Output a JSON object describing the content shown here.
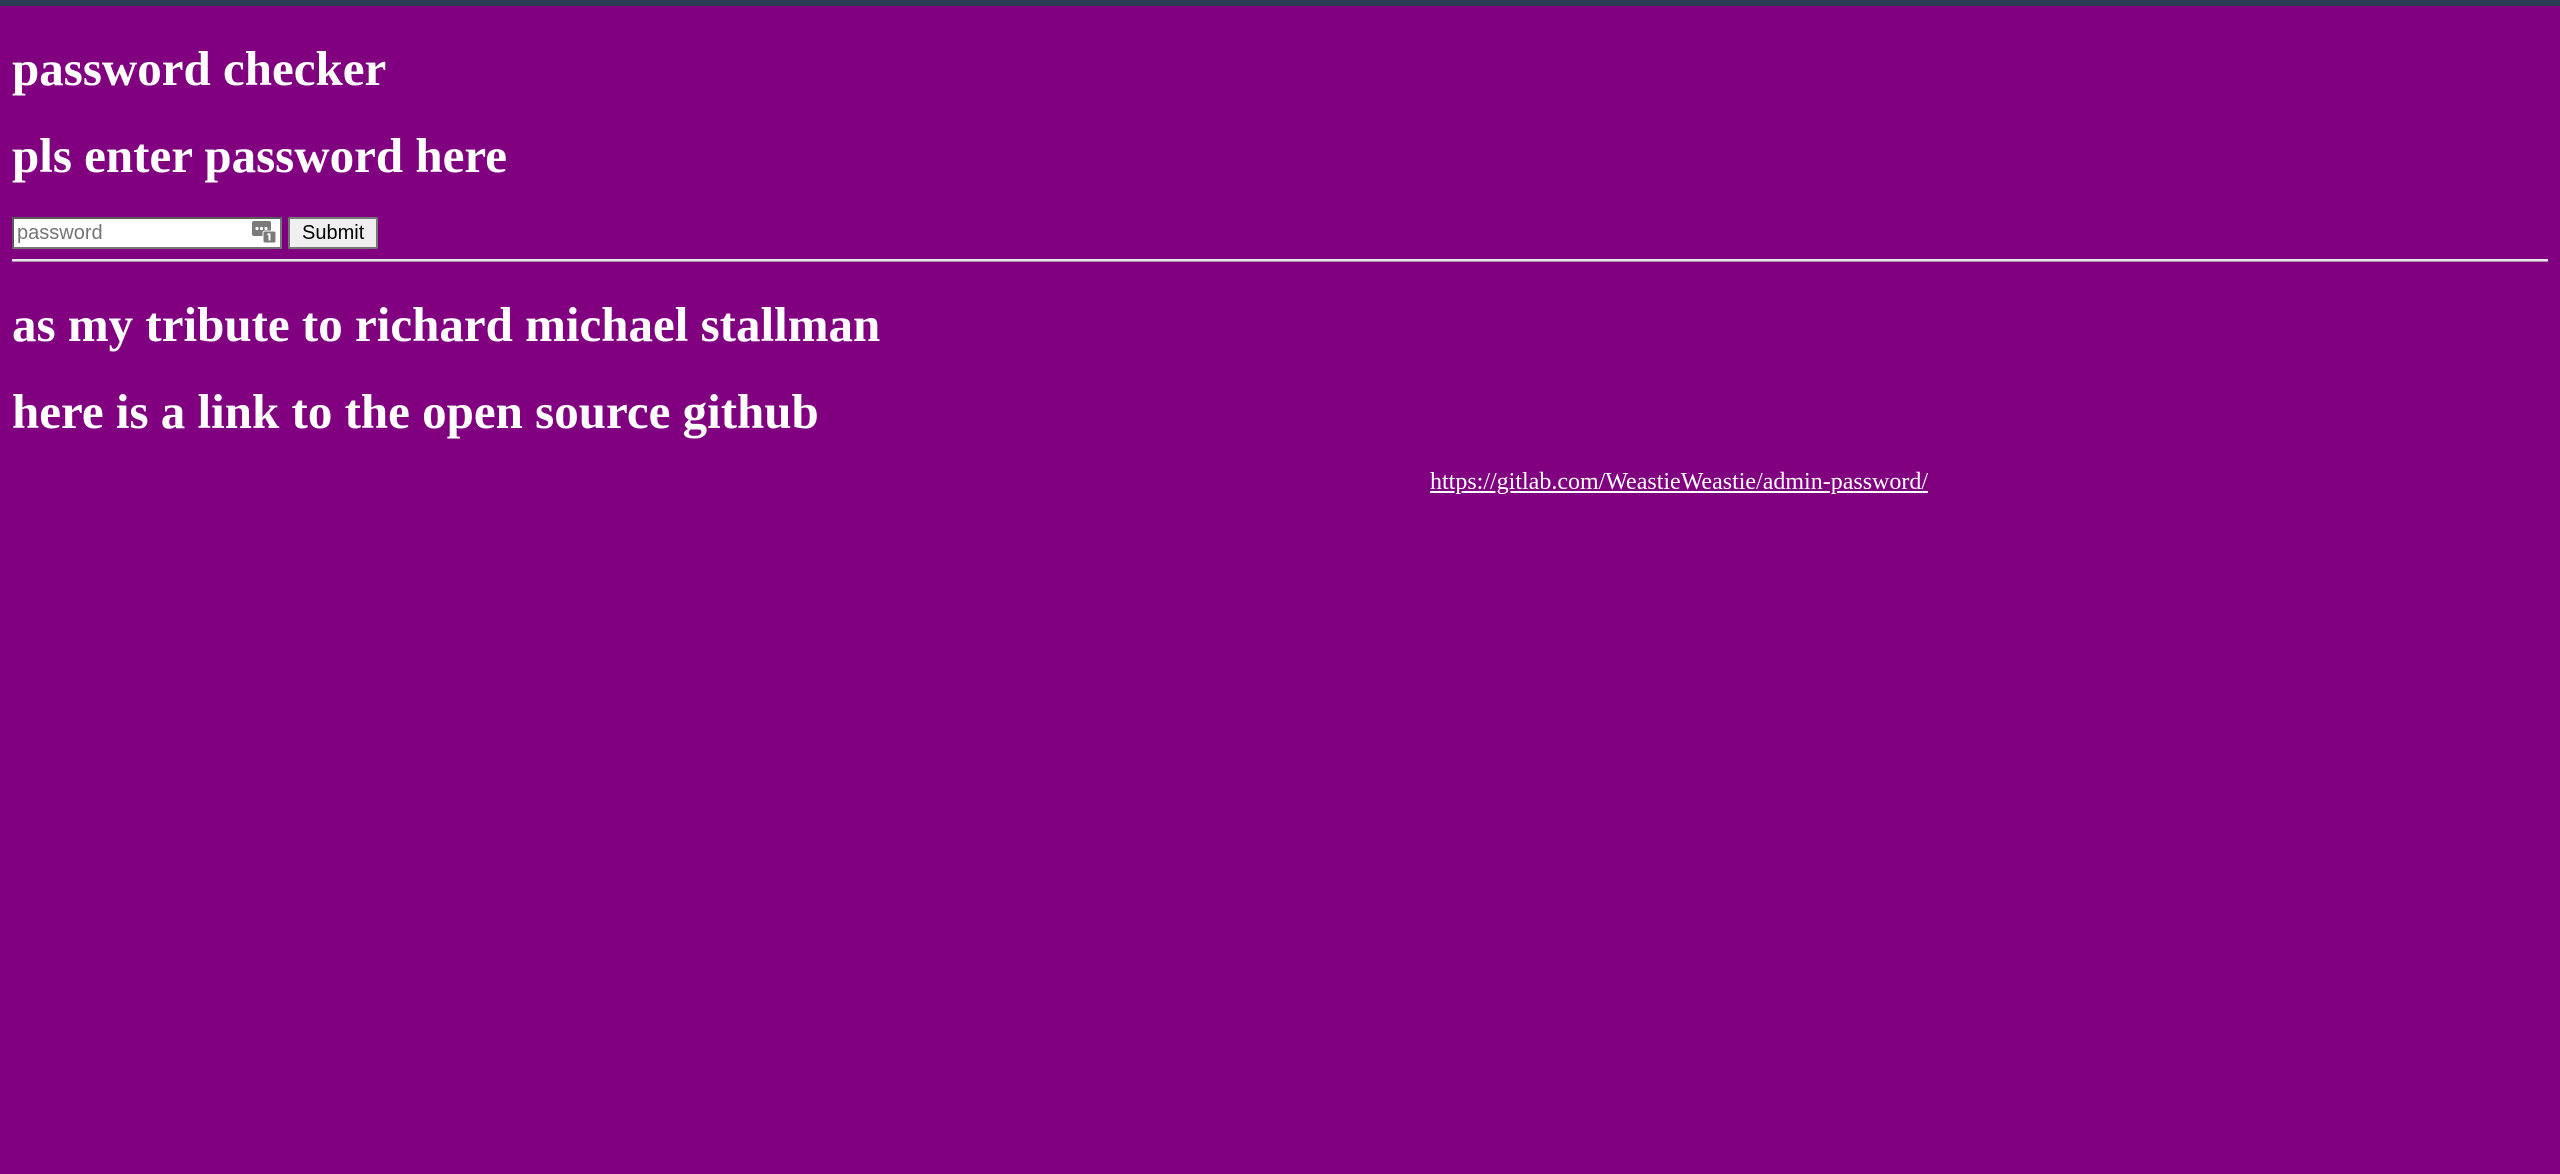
{
  "header": {
    "title": "password checker",
    "prompt": "pls enter password here"
  },
  "form": {
    "password_placeholder": "password",
    "password_value": "",
    "submit_label": "Submit",
    "key_icon": "password-manager-key-icon"
  },
  "footer": {
    "tribute": "as my tribute to richard michael stallman",
    "link_intro": "here is a link to the open source github",
    "repo_url": "https://gitlab.com/WeastieWeastie/admin-password/"
  },
  "colors": {
    "background": "#800080",
    "text": "#ffffff",
    "top_bar": "#2b3a55"
  }
}
